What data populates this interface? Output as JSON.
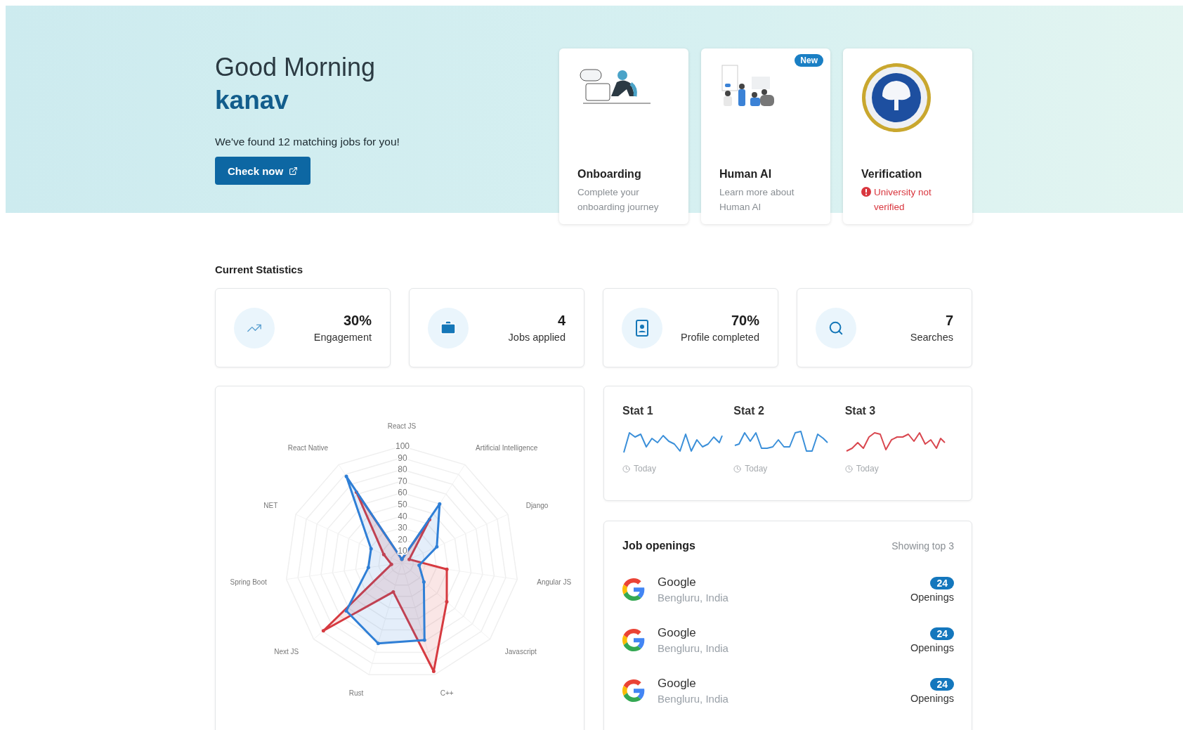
{
  "greeting": {
    "title": "Good Morning",
    "name": "kanav",
    "message": "We've found 12 matching jobs for you!",
    "button": "Check now"
  },
  "feature_cards": [
    {
      "kind": "info",
      "title": "Onboarding",
      "description": "Complete your onboarding journey"
    },
    {
      "kind": "info",
      "title": "Human AI",
      "description": "Learn more about Human AI",
      "badge": "New"
    },
    {
      "kind": "alert",
      "title": "Verification",
      "description": "University not verified"
    }
  ],
  "statistics": {
    "title": "Current Statistics",
    "items": [
      {
        "value": "30%",
        "label": "Engagement"
      },
      {
        "value": "4",
        "label": "Jobs applied"
      },
      {
        "value": "70%",
        "label": "Profile completed"
      },
      {
        "value": "7",
        "label": "Searches"
      }
    ]
  },
  "skills_chart": {
    "chart_data": {
      "type": "radar",
      "categories": [
        "React JS",
        "Artificial Intelligence",
        "Django",
        "Angular JS",
        "Javascript",
        "C++",
        "Rust",
        "Next JS",
        "Spring Boot",
        "NET",
        "React Native"
      ],
      "ylim": [
        0,
        100
      ],
      "yticks": [
        10,
        20,
        30,
        40,
        50,
        60,
        70,
        80,
        90,
        100
      ],
      "series": [
        {
          "color": "#d63a40",
          "values": [
            3,
            44,
            7,
            39,
            51,
            97,
            26,
            89,
            9,
            17,
            72
          ]
        },
        {
          "color": "#2f7fd6",
          "values": [
            3,
            60,
            33,
            15,
            25,
            69,
            72,
            63,
            29,
            29,
            88
          ]
        }
      ]
    }
  },
  "trends": [
    {
      "title": "Stat 1",
      "color": "#3a8fd9",
      "caption": "Today"
    },
    {
      "title": "Stat 2",
      "color": "#3a8fd9",
      "caption": "Today"
    },
    {
      "title": "Stat 3",
      "color": "#d9474f",
      "caption": "Today"
    }
  ],
  "job_openings": {
    "title": "Job openings",
    "note": "Showing top 3",
    "rows": [
      {
        "company": "Google",
        "location": "Bengluru, India",
        "count": "24",
        "unit": "Openings"
      },
      {
        "company": "Google",
        "location": "Bengluru, India",
        "count": "24",
        "unit": "Openings"
      },
      {
        "company": "Google",
        "location": "Bengluru, India",
        "count": "24",
        "unit": "Openings"
      }
    ]
  }
}
